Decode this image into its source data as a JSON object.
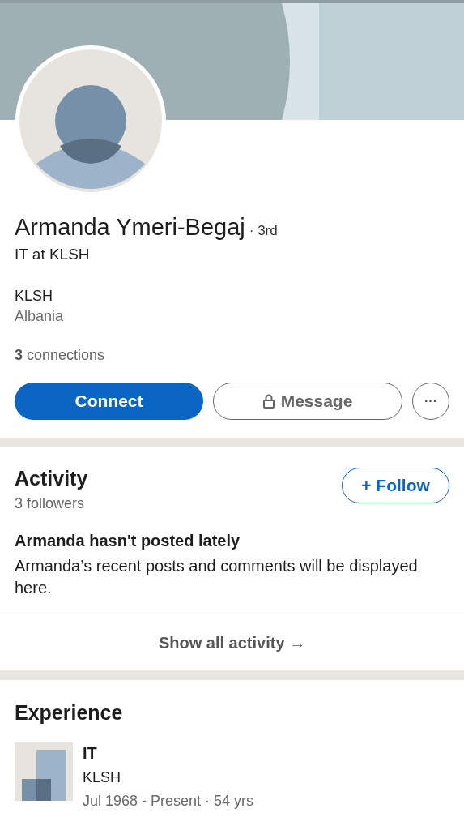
{
  "profile": {
    "name": "Armanda Ymeri-Begaj",
    "degree": "· 3rd",
    "headline": "IT at KLSH",
    "company": "KLSH",
    "location": "Albania",
    "connections": "**3** connections"
  },
  "actions": [
    {
      "kind": "primary",
      "label": "Connect"
    },
    {
      "kind": "locked",
      "label": "Message"
    },
    {
      "kind": "more",
      "label": "···"
    }
  ],
  "activity": {
    "title": "Activity",
    "followers": "3 followers",
    "follow_button": "+ Follow",
    "empty_title": "Armanda hasn't posted lately",
    "empty_text": "Armanda’s recent posts and comments will be displayed here.",
    "show_all": "Show all activity →"
  },
  "experience": {
    "title": "Experience",
    "items": [
      {
        "title": "IT",
        "company": "KLSH",
        "dates": "Jul 1968 - Present · 54 yrs"
      }
    ]
  }
}
